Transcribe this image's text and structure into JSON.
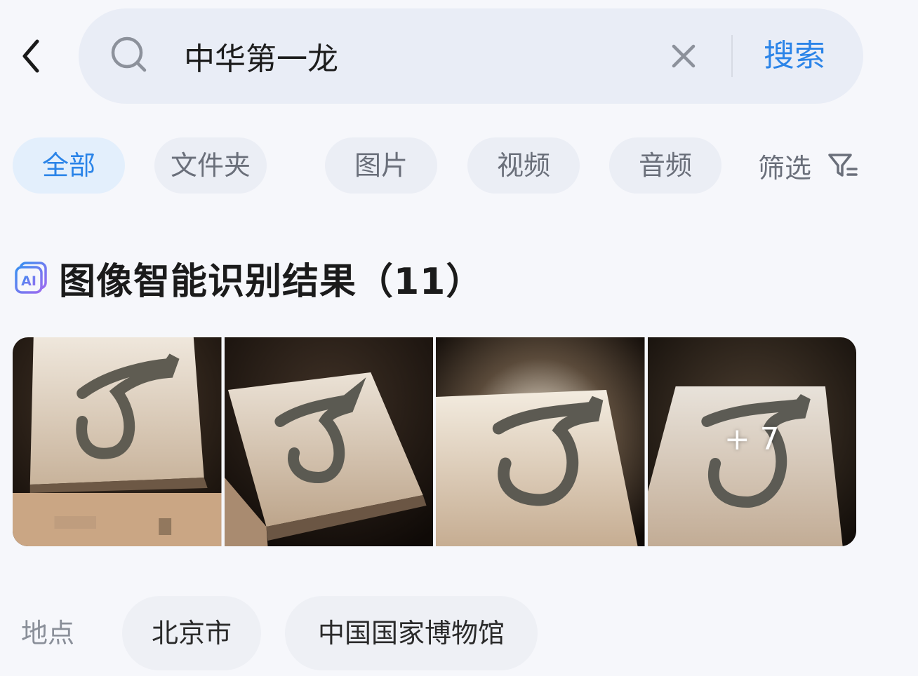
{
  "search": {
    "query": "中华第一龙",
    "button_label": "搜索"
  },
  "tabs": [
    {
      "label": "全部",
      "active": true
    },
    {
      "label": "文件夹",
      "active": false
    },
    {
      "label": "图片",
      "active": false
    },
    {
      "label": "视频",
      "active": false
    },
    {
      "label": "音频",
      "active": false
    }
  ],
  "filter": {
    "label": "筛选",
    "icon": "filter-icon"
  },
  "section": {
    "icon": "ai-icon",
    "title": "图像智能识别结果（11）"
  },
  "results": {
    "more_label": "+ 7"
  },
  "location": {
    "label": "地点",
    "chips": [
      "北京市",
      "中国国家博物馆"
    ]
  },
  "colors": {
    "accent": "#2b84e8",
    "background": "#f6f7fb",
    "search_bg": "#e9edf6",
    "active_tab_bg": "#e3effc"
  }
}
